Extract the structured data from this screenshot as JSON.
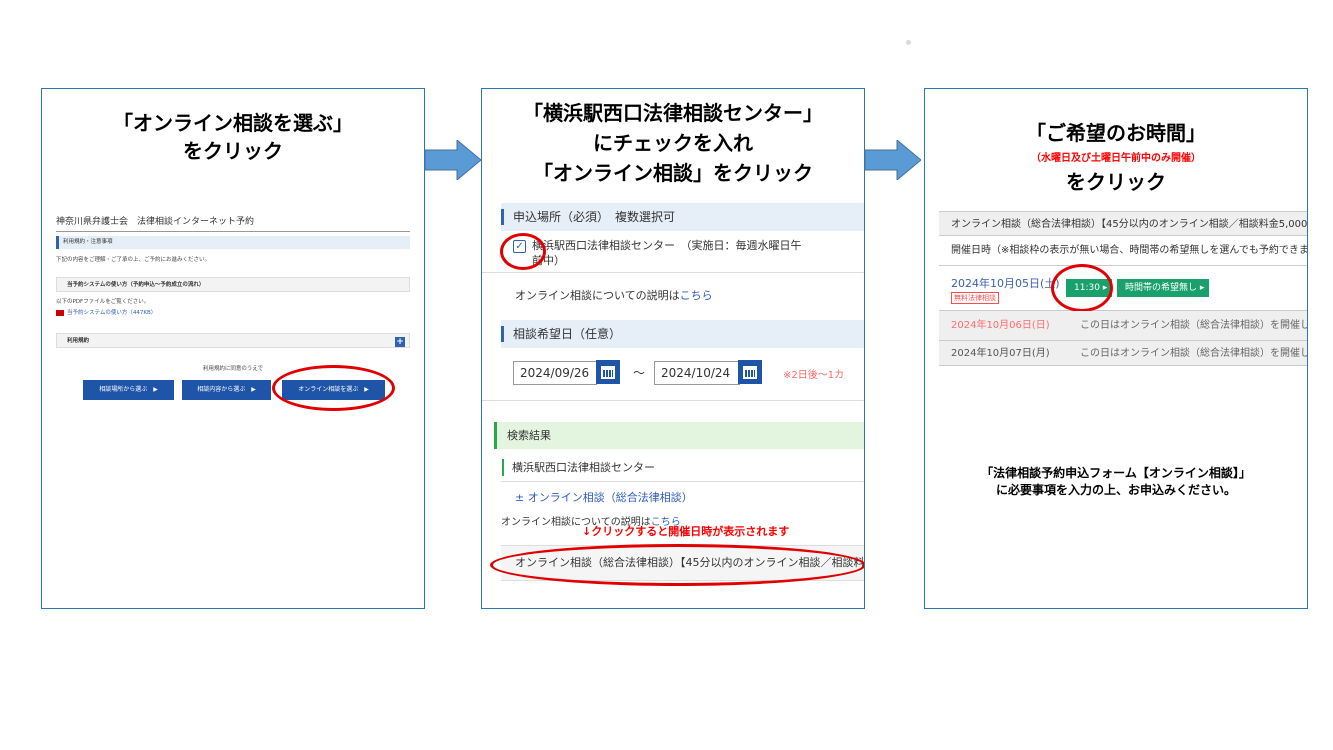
{
  "step1": {
    "title_line1": "「オンライン相談を選ぶ」",
    "title_line2": "をクリック",
    "screen": {
      "header": "神奈川県弁護士会　法律相談インターネット予約",
      "terms_bar": "利用規約・注意事項",
      "intro": "下記の内容をご理解・ご了承の上、ご予約にお進みください。",
      "how_to_title": "当予約システムの使い方（予約申込〜予約成立の流れ）",
      "pdf_note": "以下のPDFファイルをご覧ください。",
      "pdf_link": "当予約システムの使い方（447KB）",
      "terms_title": "利用規約",
      "plus_label": "+",
      "agree_text": "利用規約に同意のうえで",
      "buttons": [
        "相談場所から選ぶ　▶",
        "相談内容から選ぶ　▶",
        "オンライン相談を選ぶ　▶"
      ]
    }
  },
  "step2": {
    "title_line1": "「横浜駅西口法律相談センター」",
    "title_line2": "にチェックを入れ",
    "title_line3": "「オンライン相談」をクリック",
    "screen": {
      "place_bar": "申込場所（必須）　複数選択可",
      "check_mark": "✓",
      "center_label": "横浜駅西口法律相談センター　（実施日：毎週水曜日午前中）",
      "online_note_prefix": "オンライン相談についての説明は",
      "online_note_link": "こちら",
      "date_bar": "相談希望日（任意）",
      "date_from": "2024/09/26",
      "date_sep": "～",
      "date_to": "2024/10/24",
      "date_note": "※2日後〜1カ",
      "result_bar": "検索結果",
      "result_center": "横浜駅西口法律相談センター",
      "result_link": "± オンライン相談（総合法律相談）",
      "result_note_prefix": "オンライン相談についての説明は",
      "result_note_link": "こちら",
      "click_hint": "↓クリックすると開催日時が表示されます",
      "result_row": "オンライン相談（総合法律相談）【45分以内のオンライン相談／相談料"
    }
  },
  "step3": {
    "title_line1": "「ご希望のお時間」",
    "subtitle": "（水曜日及び土曜日午前中のみ開催）",
    "title_line2": "をクリック",
    "screen": {
      "header_row": "オンライン相談（総合法律相談）【45分以内のオンライン相談／相談料金5,000",
      "note_row": "開催日時（※相談枠の表示が無い場合、時間帯の希望無しを選んでも予約できま",
      "row1_date": "2024年10月05日(土)",
      "row1_badge": "無料法律相談",
      "row1_time": "11:30 ▸",
      "row1_no_pref": "時間帯の希望無し ▸",
      "row2_date": "2024年10月06日(日)",
      "row2_text": "この日はオンライン相談（総合法律相談）を開催し",
      "row3_date": "2024年10月07日(月)",
      "row3_text": "この日はオンライン相談（総合法律相談）を開催し"
    },
    "footer_line1": "「法律相談予約申込フォーム【オンライン相談】」",
    "footer_line2": "に必要事項を入力の上、お申込みください。"
  },
  "colors": {
    "frame": "#2e75b6",
    "arrow": "#5b9bd5",
    "highlight": "#e00000",
    "button_blue": "#1f55a8",
    "button_green": "#1aa06a"
  }
}
